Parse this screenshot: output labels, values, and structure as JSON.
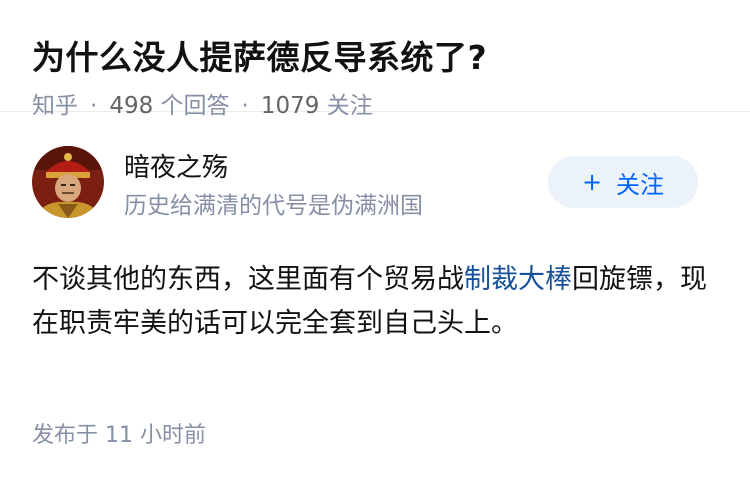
{
  "question": {
    "title": "为什么没人提萨德反导系统了?",
    "source": "知乎",
    "answer_count": "498",
    "answer_count_label": "个回答",
    "follower_count": "1079",
    "follower_count_label": "关注"
  },
  "answer": {
    "author": {
      "name": "暗夜之殇",
      "bio": "历史给满清的代号是伪满洲国",
      "avatar": "avatar-qing-emperor-photo"
    },
    "follow_button": {
      "icon": "plus-icon",
      "label": "关注"
    },
    "content": {
      "part1": "不谈其他的东西，这里面有个贸易战",
      "link_text": "制裁大棒",
      "part2": "回旋镖，现在职责牢美的话可以完全套到自己头上。"
    },
    "time": "发布于 11 小时前"
  },
  "colors": {
    "meta": "#8590a6",
    "link": "#175199",
    "button_bg": "#ebf2fa",
    "button_text": "#0066ff"
  }
}
